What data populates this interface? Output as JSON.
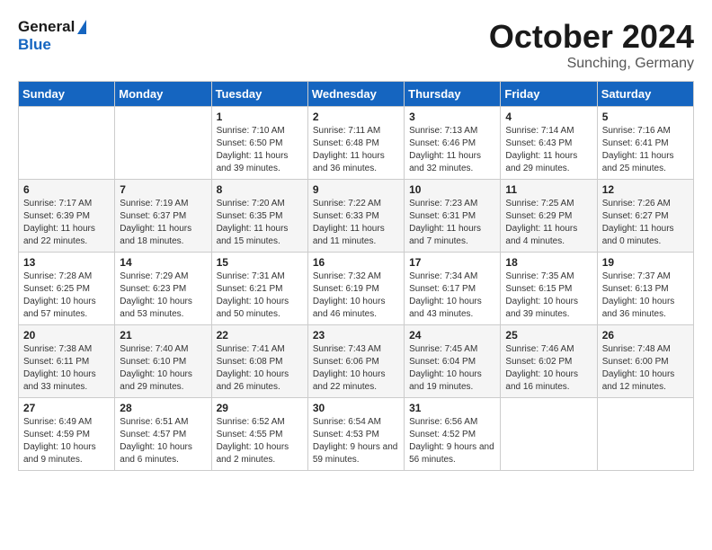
{
  "header": {
    "logo_line1": "General",
    "logo_line2": "Blue",
    "month": "October 2024",
    "location": "Sunching, Germany"
  },
  "weekdays": [
    "Sunday",
    "Monday",
    "Tuesday",
    "Wednesday",
    "Thursday",
    "Friday",
    "Saturday"
  ],
  "weeks": [
    [
      {
        "day": "",
        "info": ""
      },
      {
        "day": "",
        "info": ""
      },
      {
        "day": "1",
        "info": "Sunrise: 7:10 AM\nSunset: 6:50 PM\nDaylight: 11 hours and 39 minutes."
      },
      {
        "day": "2",
        "info": "Sunrise: 7:11 AM\nSunset: 6:48 PM\nDaylight: 11 hours and 36 minutes."
      },
      {
        "day": "3",
        "info": "Sunrise: 7:13 AM\nSunset: 6:46 PM\nDaylight: 11 hours and 32 minutes."
      },
      {
        "day": "4",
        "info": "Sunrise: 7:14 AM\nSunset: 6:43 PM\nDaylight: 11 hours and 29 minutes."
      },
      {
        "day": "5",
        "info": "Sunrise: 7:16 AM\nSunset: 6:41 PM\nDaylight: 11 hours and 25 minutes."
      }
    ],
    [
      {
        "day": "6",
        "info": "Sunrise: 7:17 AM\nSunset: 6:39 PM\nDaylight: 11 hours and 22 minutes."
      },
      {
        "day": "7",
        "info": "Sunrise: 7:19 AM\nSunset: 6:37 PM\nDaylight: 11 hours and 18 minutes."
      },
      {
        "day": "8",
        "info": "Sunrise: 7:20 AM\nSunset: 6:35 PM\nDaylight: 11 hours and 15 minutes."
      },
      {
        "day": "9",
        "info": "Sunrise: 7:22 AM\nSunset: 6:33 PM\nDaylight: 11 hours and 11 minutes."
      },
      {
        "day": "10",
        "info": "Sunrise: 7:23 AM\nSunset: 6:31 PM\nDaylight: 11 hours and 7 minutes."
      },
      {
        "day": "11",
        "info": "Sunrise: 7:25 AM\nSunset: 6:29 PM\nDaylight: 11 hours and 4 minutes."
      },
      {
        "day": "12",
        "info": "Sunrise: 7:26 AM\nSunset: 6:27 PM\nDaylight: 11 hours and 0 minutes."
      }
    ],
    [
      {
        "day": "13",
        "info": "Sunrise: 7:28 AM\nSunset: 6:25 PM\nDaylight: 10 hours and 57 minutes."
      },
      {
        "day": "14",
        "info": "Sunrise: 7:29 AM\nSunset: 6:23 PM\nDaylight: 10 hours and 53 minutes."
      },
      {
        "day": "15",
        "info": "Sunrise: 7:31 AM\nSunset: 6:21 PM\nDaylight: 10 hours and 50 minutes."
      },
      {
        "day": "16",
        "info": "Sunrise: 7:32 AM\nSunset: 6:19 PM\nDaylight: 10 hours and 46 minutes."
      },
      {
        "day": "17",
        "info": "Sunrise: 7:34 AM\nSunset: 6:17 PM\nDaylight: 10 hours and 43 minutes."
      },
      {
        "day": "18",
        "info": "Sunrise: 7:35 AM\nSunset: 6:15 PM\nDaylight: 10 hours and 39 minutes."
      },
      {
        "day": "19",
        "info": "Sunrise: 7:37 AM\nSunset: 6:13 PM\nDaylight: 10 hours and 36 minutes."
      }
    ],
    [
      {
        "day": "20",
        "info": "Sunrise: 7:38 AM\nSunset: 6:11 PM\nDaylight: 10 hours and 33 minutes."
      },
      {
        "day": "21",
        "info": "Sunrise: 7:40 AM\nSunset: 6:10 PM\nDaylight: 10 hours and 29 minutes."
      },
      {
        "day": "22",
        "info": "Sunrise: 7:41 AM\nSunset: 6:08 PM\nDaylight: 10 hours and 26 minutes."
      },
      {
        "day": "23",
        "info": "Sunrise: 7:43 AM\nSunset: 6:06 PM\nDaylight: 10 hours and 22 minutes."
      },
      {
        "day": "24",
        "info": "Sunrise: 7:45 AM\nSunset: 6:04 PM\nDaylight: 10 hours and 19 minutes."
      },
      {
        "day": "25",
        "info": "Sunrise: 7:46 AM\nSunset: 6:02 PM\nDaylight: 10 hours and 16 minutes."
      },
      {
        "day": "26",
        "info": "Sunrise: 7:48 AM\nSunset: 6:00 PM\nDaylight: 10 hours and 12 minutes."
      }
    ],
    [
      {
        "day": "27",
        "info": "Sunrise: 6:49 AM\nSunset: 4:59 PM\nDaylight: 10 hours and 9 minutes."
      },
      {
        "day": "28",
        "info": "Sunrise: 6:51 AM\nSunset: 4:57 PM\nDaylight: 10 hours and 6 minutes."
      },
      {
        "day": "29",
        "info": "Sunrise: 6:52 AM\nSunset: 4:55 PM\nDaylight: 10 hours and 2 minutes."
      },
      {
        "day": "30",
        "info": "Sunrise: 6:54 AM\nSunset: 4:53 PM\nDaylight: 9 hours and 59 minutes."
      },
      {
        "day": "31",
        "info": "Sunrise: 6:56 AM\nSunset: 4:52 PM\nDaylight: 9 hours and 56 minutes."
      },
      {
        "day": "",
        "info": ""
      },
      {
        "day": "",
        "info": ""
      }
    ]
  ]
}
